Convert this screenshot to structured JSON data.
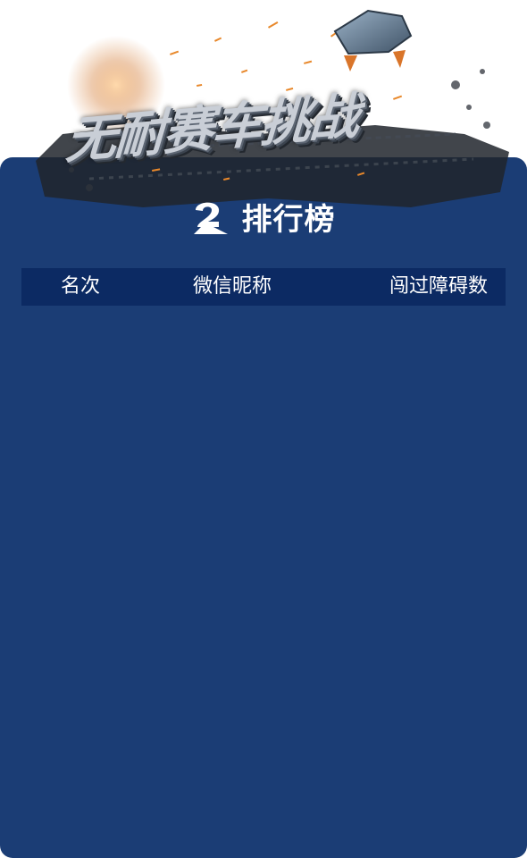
{
  "banner": {
    "title": "无耐赛车挑战"
  },
  "leaderboard": {
    "title": "排行榜",
    "icon": "leaderboard-logo-icon",
    "columns": [
      "名次",
      "微信昵称",
      "闯过障碍数"
    ],
    "rows": []
  },
  "colors": {
    "panel": "#1b3d75",
    "header_bar": "#0c2a63",
    "text": "#ffffff"
  }
}
